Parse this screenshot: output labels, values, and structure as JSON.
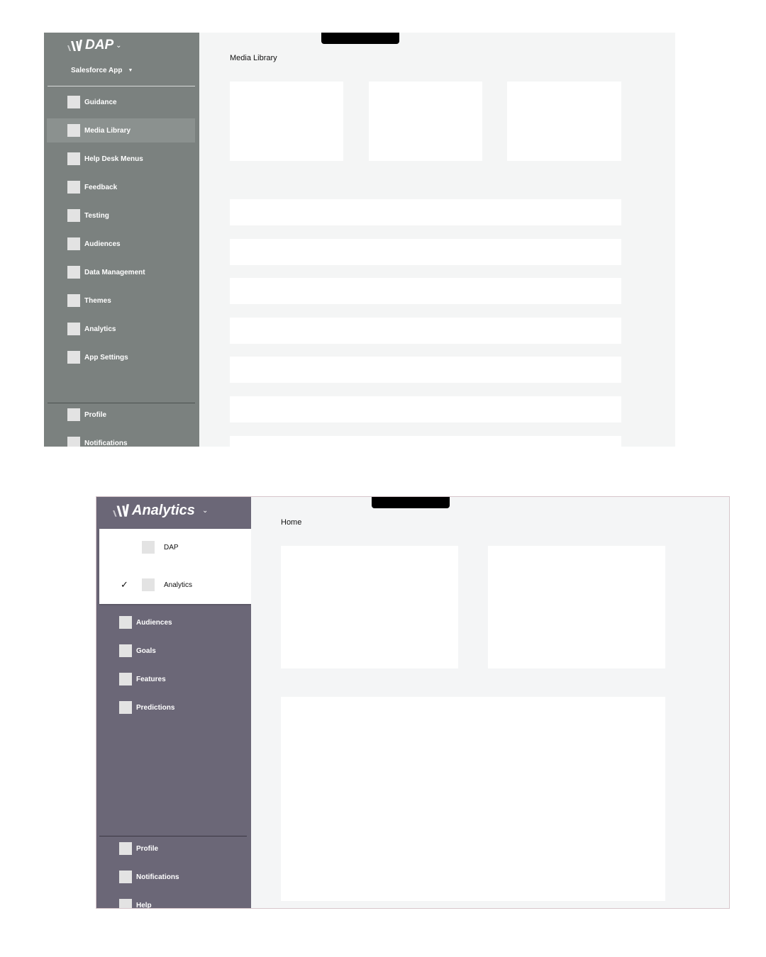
{
  "dap": {
    "brand": {
      "name": "DAP",
      "chevron": "⌄"
    },
    "app_switch": {
      "label": "Salesforce App",
      "caret": "▼"
    },
    "nav_items": [
      {
        "label": "Guidance"
      },
      {
        "label": "Media Library",
        "active": true
      },
      {
        "label": "Help Desk Menus"
      },
      {
        "label": "Feedback"
      },
      {
        "label": "Testing"
      },
      {
        "label": "Audiences"
      },
      {
        "label": "Data Management"
      },
      {
        "label": "Themes"
      },
      {
        "label": "Analytics"
      },
      {
        "label": "App Settings"
      }
    ],
    "footer_items": [
      {
        "label": "Profile"
      },
      {
        "label": "Notifications"
      }
    ],
    "page_title": "Media Library"
  },
  "analytics": {
    "brand": {
      "name": "Analytics",
      "chevron": "⌄"
    },
    "switcher_options": [
      {
        "label": "DAP",
        "checked": false
      },
      {
        "label": "Analytics",
        "checked": true,
        "check_glyph": "✓"
      }
    ],
    "nav_items": [
      {
        "label": "Audiences"
      },
      {
        "label": "Goals"
      },
      {
        "label": "Features"
      },
      {
        "label": "Predictions"
      }
    ],
    "footer_items": [
      {
        "label": "Profile"
      },
      {
        "label": "Notifications"
      },
      {
        "label": "Help"
      }
    ],
    "page_title": "Home"
  },
  "colors": {
    "dap_sidebar": "#7b817f",
    "dap_active_item": "#8b918f",
    "analytics_sidebar": "#6b6777",
    "content_bg": "#f4f5f5",
    "placeholder_square": "#e3e3e3"
  }
}
